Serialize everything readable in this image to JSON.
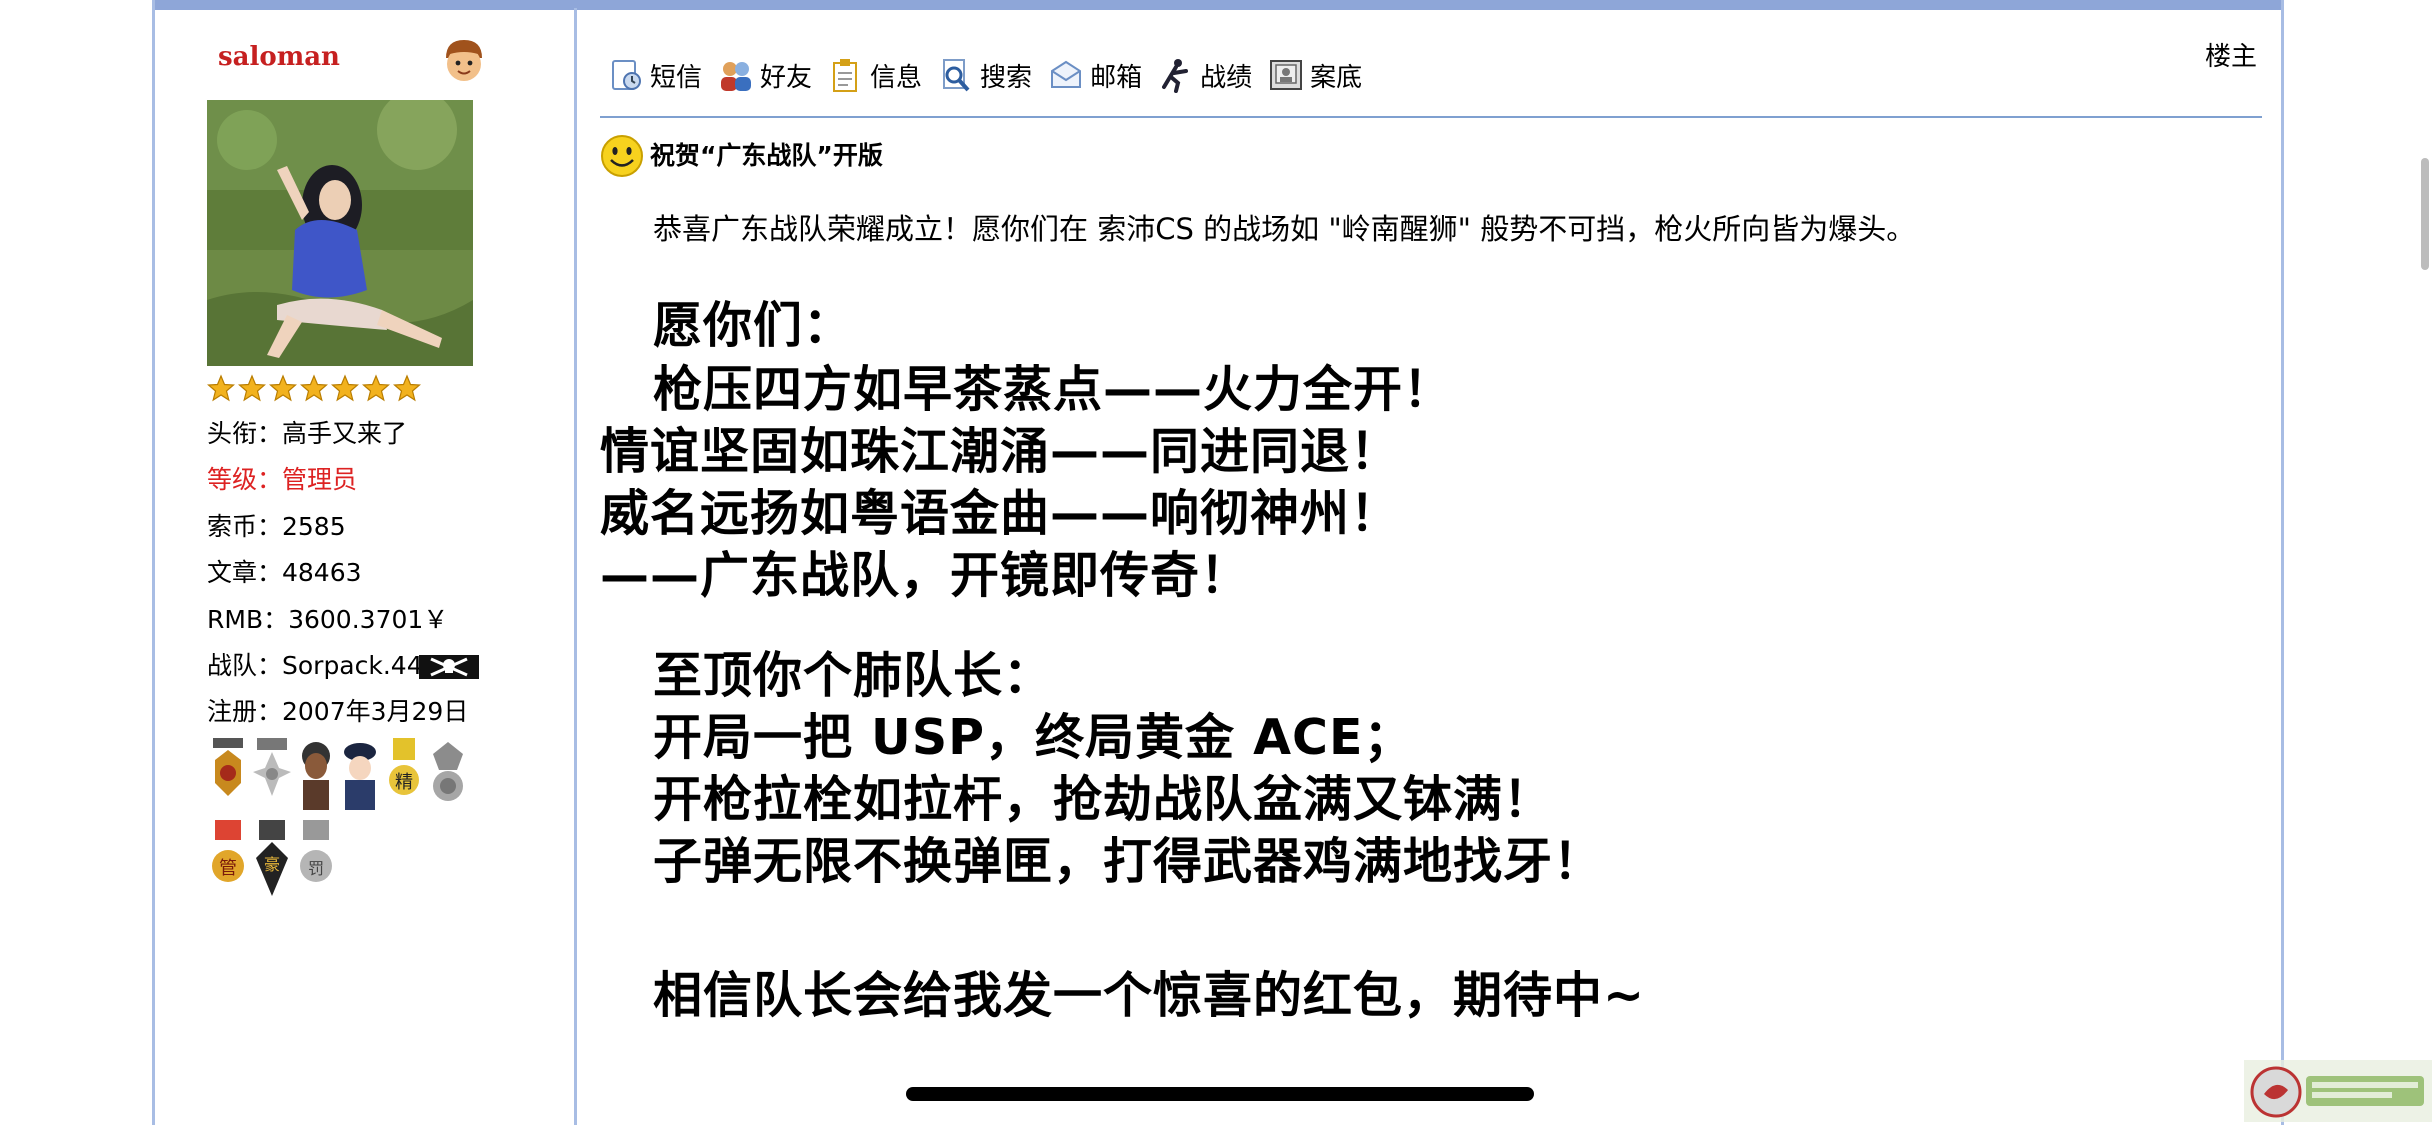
{
  "profile": {
    "username": "saloman",
    "star_count": 7,
    "info": {
      "title": "头衔：高手又来了",
      "level": "等级：管理员",
      "coins": "索币：2585",
      "posts": "文章：48463",
      "rmb": "RMB：3600.3701￥",
      "team": "战队：Sorpack.44",
      "registered": "注册：2007年3月29日"
    },
    "medals": [
      "管",
      "豪",
      "罚",
      "精"
    ]
  },
  "toolbar": {
    "items": [
      {
        "label": "短信",
        "icon": "message-icon"
      },
      {
        "label": "好友",
        "icon": "friends-icon"
      },
      {
        "label": "信息",
        "icon": "info-icon"
      },
      {
        "label": "搜索",
        "icon": "search-icon"
      },
      {
        "label": "邮箱",
        "icon": "mailbox-icon"
      },
      {
        "label": "战绩",
        "icon": "record-icon"
      },
      {
        "label": "案底",
        "icon": "file-icon"
      }
    ],
    "floor": "楼主"
  },
  "post": {
    "title": "祝贺“广东战队”开版",
    "intro": "恭喜广东战队荣耀成立！愿你们在 索沛CS 的战场如 \"岭南醒狮\" 般势不可挡，枪火所向皆为爆头。",
    "poem": {
      "heading": "愿你们：",
      "lines": [
        "枪压四方如早茶蒸点——火力全开！",
        "情谊坚固如珠江潮涌——同进同退！",
        "威名远扬如粤语金曲——响彻神州！",
        "——广东战队，开镜即传奇！"
      ]
    },
    "captain": {
      "heading": "至顶你个肺队长：",
      "lines": [
        "开局一把 USP，终局黄金 ACE；",
        "开枪拉栓如拉杆，抢劫战队盆满又钵满！",
        "子弹无限不换弹匣，打得武器鸡满地找牙！"
      ]
    },
    "closing": "相信队长会给我发一个惊喜的红包，期待中~"
  },
  "colors": {
    "frame": "#8ea6d8",
    "border": "#a8bde4",
    "username": "#c62020",
    "level": "#dd2222",
    "toolbar_rule": "#7fa0d0"
  }
}
